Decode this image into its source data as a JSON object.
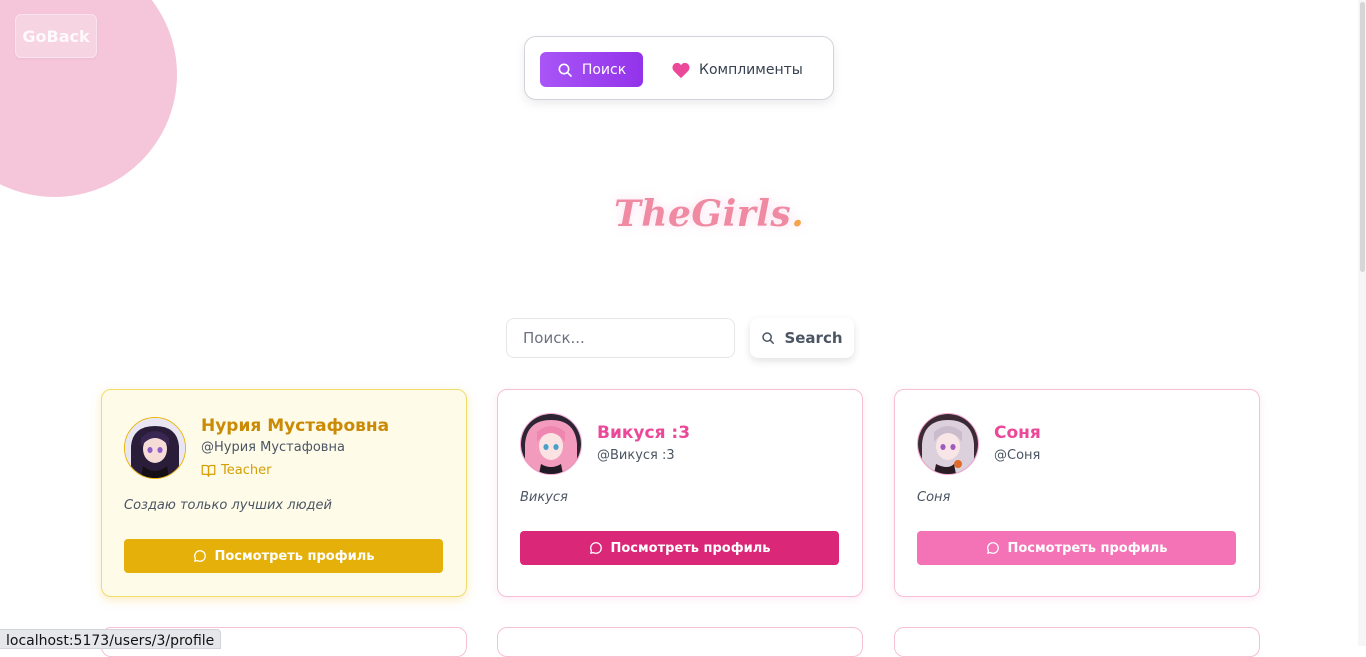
{
  "goback": {
    "label": "GoBack"
  },
  "nav": {
    "search_label": "Поиск",
    "compliments_label": "Комплименты"
  },
  "logo": {
    "text": "TheGirls",
    "dot": "."
  },
  "search": {
    "placeholder": "Поиск...",
    "value": "",
    "button_label": "Search"
  },
  "colors": {
    "accent_purple": "#9333ea",
    "pink": "#ec4899",
    "gold": "#eab308"
  },
  "cards": [
    {
      "name": "Нурия Мустафовна",
      "handle": "@Нурия Мустафовна",
      "role": "Teacher",
      "bio": "Создаю только лучших людей",
      "button_label": "Посмотреть профиль",
      "name_color": "#ca8a04",
      "button_color": "#eab308"
    },
    {
      "name": "Викуся :3",
      "handle": "@Викуся :3",
      "bio": "Викуся",
      "button_label": "Посмотреть профиль",
      "name_color": "#ec4899",
      "button_color": "#db2777"
    },
    {
      "name": "Соня",
      "handle": "@Соня",
      "bio": "Соня",
      "button_label": "Посмотреть профиль",
      "name_color": "#ec4899",
      "button_color": "#f472b6"
    }
  ],
  "status_bar": {
    "url": "localhost:5173/users/3/profile"
  }
}
